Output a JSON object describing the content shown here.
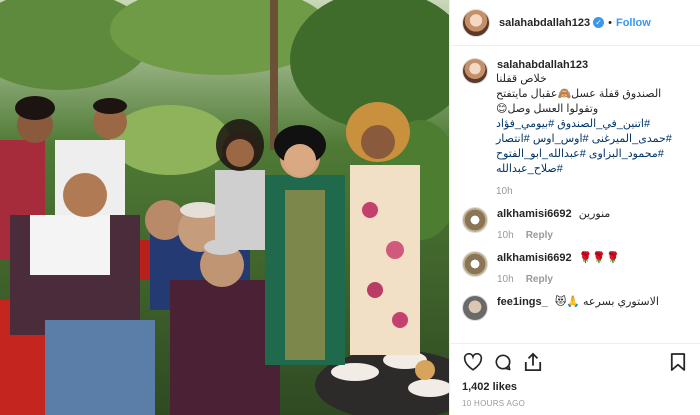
{
  "post": {
    "username": "salahabdallah123",
    "verified_glyph": "✓",
    "separator": "•",
    "follow_label": "Follow",
    "photo_icon": "group-photo",
    "caption": {
      "username": "salahabdallah123",
      "lines": [
        "خلاص قفلنا",
        "الصندوق قفلة عسل🙈عقبال مايتفتح",
        "وتقولوا العسل وصل😊",
        "#اتنين_في_الصندوق #بيومي_فؤاد",
        "#حمدى_الميرغنى #اوس_اوس #انتصار",
        "#محمود_البزاوى #عبدالله_ابو_الفتوح",
        "#صلاح_عبدالله"
      ],
      "time": "10h"
    },
    "comments": [
      {
        "username": "alkhamisi6692",
        "text": "منورين",
        "time": "10h",
        "reply_label": "Reply",
        "avatar_icon": "avatar-calligraphy"
      },
      {
        "username": "alkhamisi6692",
        "text": "🌹🌹🌹",
        "time": "10h",
        "reply_label": "Reply",
        "avatar_icon": "avatar-calligraphy"
      },
      {
        "username": "fee1ings_",
        "text": "الاستوري بسرعه 🙏😻",
        "avatar_icon": "avatar-person"
      }
    ],
    "likes": "1,402 likes",
    "timestamp": "10 HOURS AGO",
    "icons": [
      "heart-icon",
      "comment-icon",
      "share-icon",
      "bookmark-icon"
    ]
  }
}
